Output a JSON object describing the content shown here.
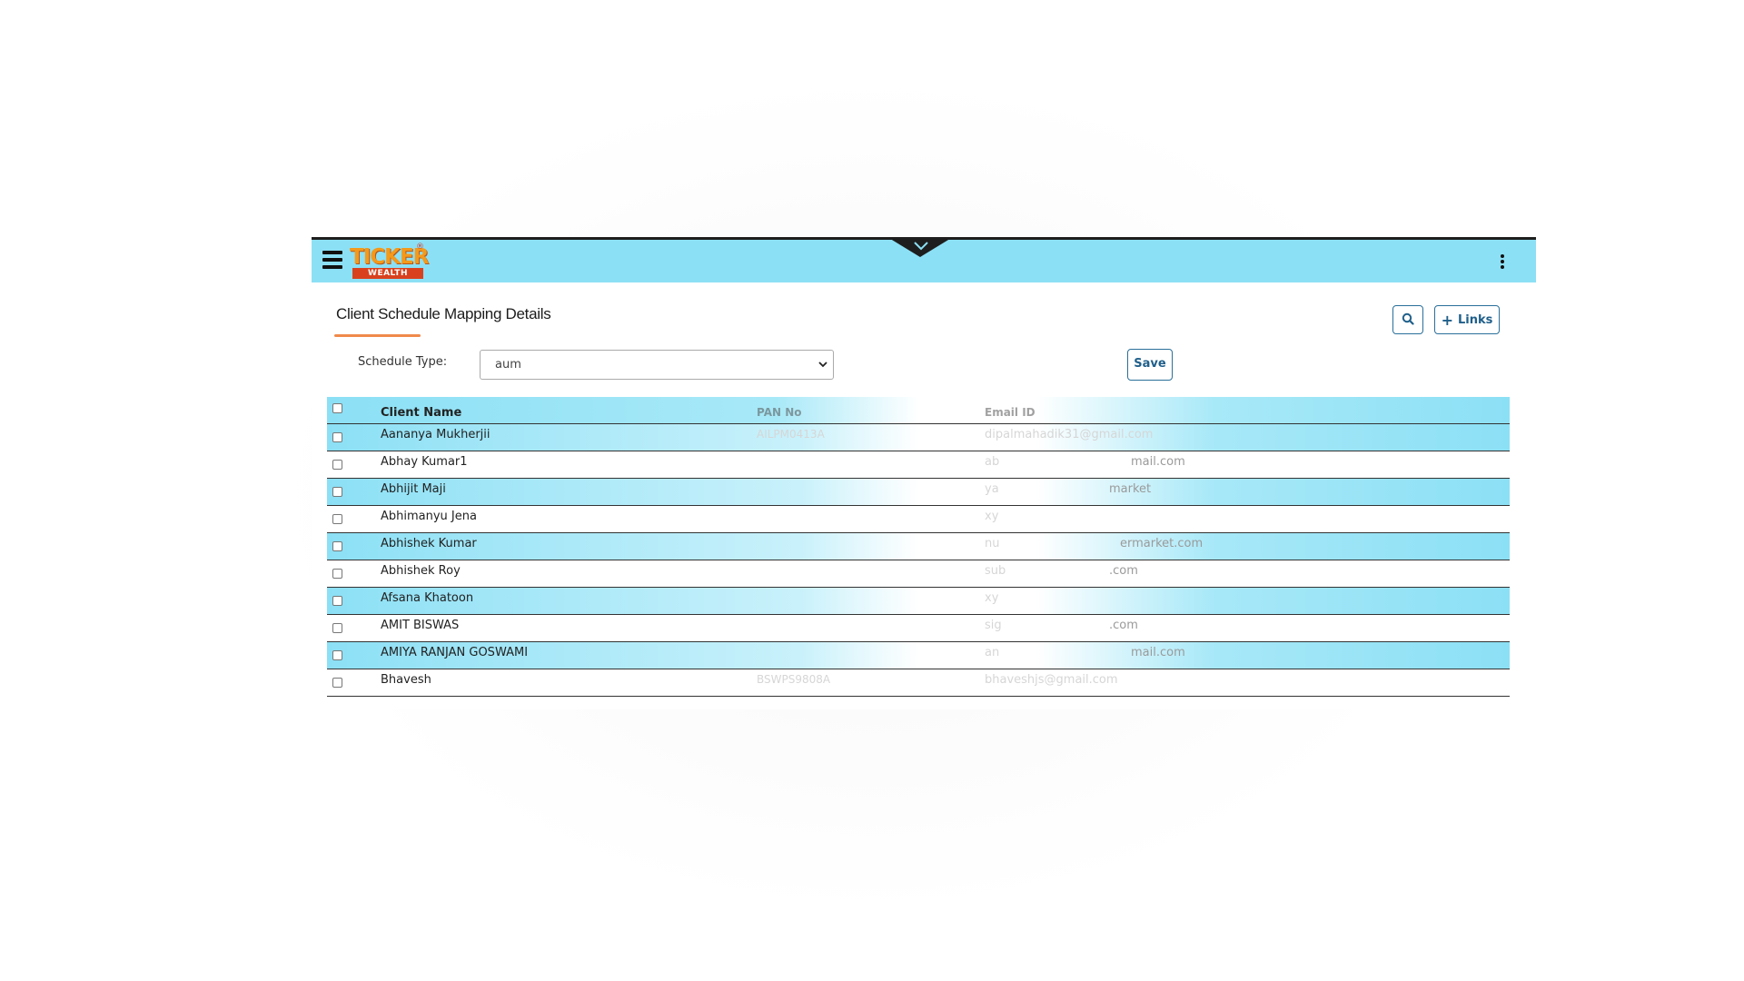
{
  "header": {
    "logo_top": "TICKER",
    "logo_bottom": "WEALTH",
    "logo_reg": "®"
  },
  "page": {
    "title": "Client Schedule Mapping Details",
    "links_label": "Links"
  },
  "filter": {
    "schedule_label": "Schedule Type:",
    "schedule_value": "aum",
    "save_label": "Save"
  },
  "table": {
    "columns": [
      "Client Name",
      "PAN No",
      "Email ID"
    ],
    "rows": [
      {
        "name": "Aananya Mukherjii",
        "pan": "AILPM0413A",
        "email": "dipalmahadik31@gmail.com"
      },
      {
        "name": "Abhay Kumar1",
        "pan": "",
        "email": "ab",
        "email_tail": "mail.com"
      },
      {
        "name": "Abhijit Maji",
        "pan": "",
        "email": "ya",
        "email_tail": "market"
      },
      {
        "name": "Abhimanyu Jena",
        "pan": "",
        "email": "xy"
      },
      {
        "name": "Abhishek Kumar",
        "pan": "",
        "email": "nu",
        "email_tail": "ermarket.com"
      },
      {
        "name": "Abhishek Roy",
        "pan": "",
        "email": "sub",
        "email_tail": ".com"
      },
      {
        "name": "Afsana Khatoon",
        "pan": "",
        "email": "xy"
      },
      {
        "name": "AMIT BISWAS",
        "pan": "",
        "email": "sig",
        "email_tail": ".com"
      },
      {
        "name": "AMIYA RANJAN GOSWAMI",
        "pan": "",
        "email": "an",
        "email_tail": "mail.com"
      },
      {
        "name": "Bhavesh",
        "pan": "BSWPS9808A",
        "email": "bhaveshjs@gmail.com"
      }
    ]
  },
  "icons": {
    "menu": "hamburger-icon",
    "collapse": "chevron-down-icon",
    "more": "kebab-menu-icon",
    "search": "search-icon",
    "add": "plus-icon"
  },
  "colors": {
    "accent_cyan": "#8ce0f5",
    "button_blue": "#2a6f9a",
    "underline_orange": "#f08a4b",
    "logo_orange": "#f39a1c",
    "logo_red": "#d9411e"
  }
}
